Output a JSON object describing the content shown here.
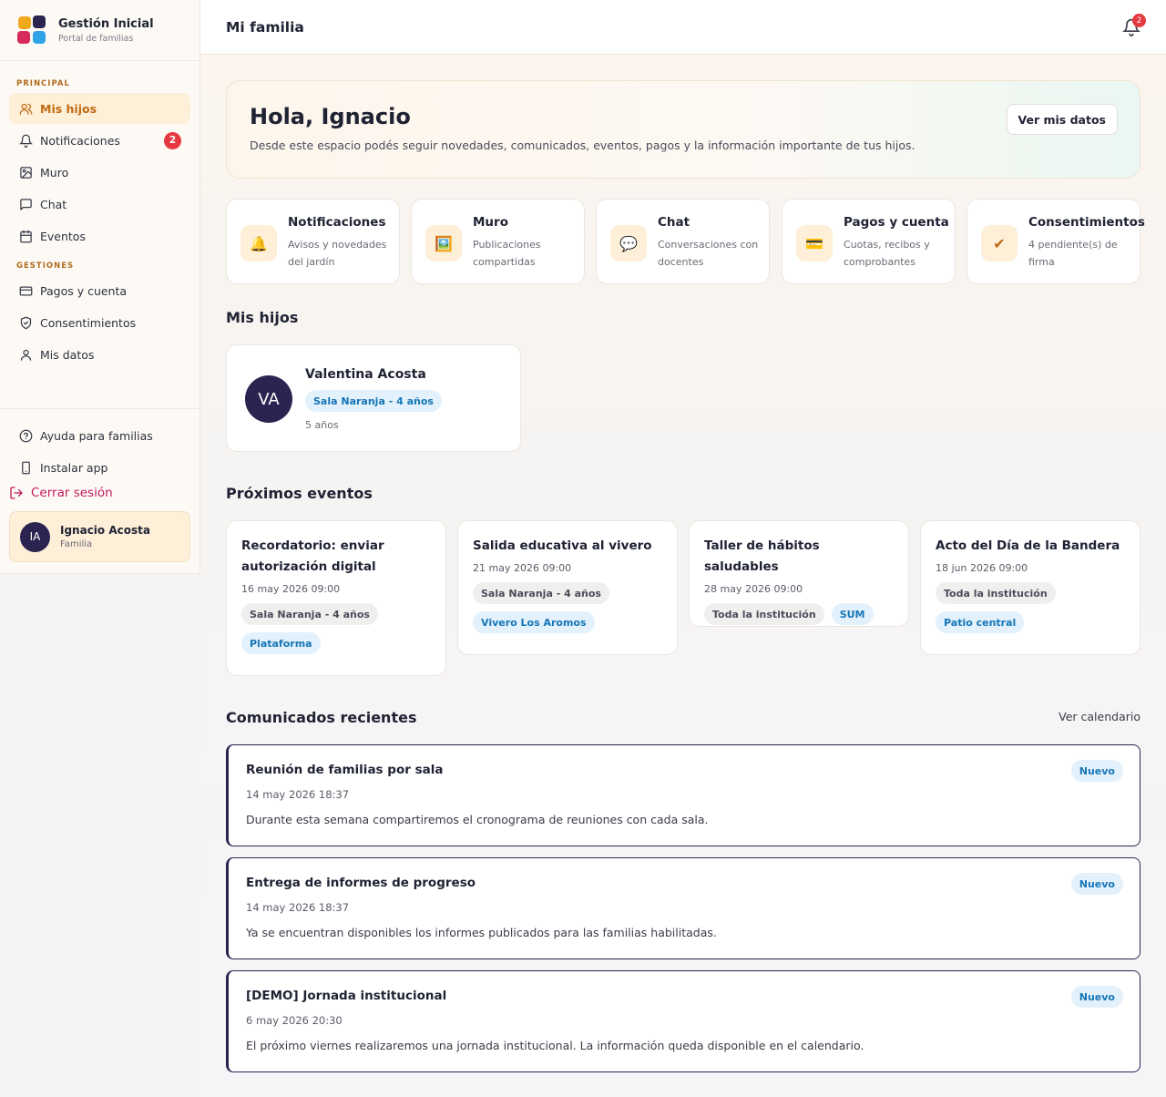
{
  "brand": {
    "title": "Gestión Inicial",
    "subtitle": "Portal de familias"
  },
  "sidebar": {
    "section_principal": "PRINCIPAL",
    "section_gestiones": "GESTIONES",
    "items": [
      {
        "label": "Mis hijos",
        "icon": "users-icon"
      },
      {
        "label": "Notificaciones",
        "icon": "bell-icon",
        "badge": "2"
      },
      {
        "label": "Muro",
        "icon": "image-icon"
      },
      {
        "label": "Chat",
        "icon": "chat-icon"
      },
      {
        "label": "Eventos",
        "icon": "calendar-icon"
      },
      {
        "label": "Pagos y cuenta",
        "icon": "credit-card-icon"
      },
      {
        "label": "Consentimientos",
        "icon": "shield-check-icon"
      },
      {
        "label": "Mis datos",
        "icon": "user-icon"
      },
      {
        "label": "Ayuda para familias",
        "icon": "help-circle-icon"
      },
      {
        "label": "Instalar app",
        "icon": "smartphone-icon"
      }
    ],
    "logout": "Cerrar sesión",
    "user": {
      "initials": "IA",
      "name": "Ignacio Acosta",
      "role": "Familia"
    }
  },
  "header": {
    "title": "Mi familia",
    "bell_badge": "2"
  },
  "hero": {
    "greeting": "Hola, Ignacio",
    "subtitle": "Desde este espacio podés seguir novedades, comunicados, eventos, pagos y la información importante de tus hijos.",
    "button": "Ver mis datos"
  },
  "quick_links": [
    {
      "title": "Notificaciones",
      "desc": "Avisos y novedades del jardín",
      "icon": "🔔"
    },
    {
      "title": "Muro",
      "desc": "Publicaciones compartidas",
      "icon": "🖼️"
    },
    {
      "title": "Chat",
      "desc": "Conversaciones con docentes",
      "icon": "💬"
    },
    {
      "title": "Pagos y cuenta",
      "desc": "Cuotas, recibos y comprobantes",
      "icon": "💳"
    },
    {
      "title": "Consentimientos",
      "desc": "4 pendiente(s) de firma",
      "icon": "✔"
    }
  ],
  "children_section": {
    "title": "Mis hijos",
    "child": {
      "initials": "VA",
      "name": "Valentina Acosta",
      "room": "Sala Naranja - 4 años",
      "age": "5 años"
    }
  },
  "events_section": {
    "title": "Próximos eventos",
    "events": [
      {
        "title": "Recordatorio: enviar autorización digital",
        "date": "16 may 2026 09:00",
        "tag1": "Sala Naranja - 4 años",
        "tag2": "Plataforma"
      },
      {
        "title": "Salida educativa al vivero",
        "date": "21 may 2026 09:00",
        "tag1": "Sala Naranja - 4 años",
        "tag2": "Vivero Los Aromos"
      },
      {
        "title": "Taller de hábitos saludables",
        "date": "28 may 2026 09:00",
        "tag1": "Toda la institución",
        "tag2": "SUM"
      },
      {
        "title": "Acto del Día de la Bandera",
        "date": "18 jun 2026 09:00",
        "tag1": "Toda la institución",
        "tag2": "Patio central"
      }
    ]
  },
  "notices_section": {
    "title": "Comunicados recientes",
    "link": "Ver calendario",
    "notices": [
      {
        "title": "Reunión de familias por sala",
        "date": "14 may 2026 18:37",
        "body": "Durante esta semana compartiremos el cronograma de reuniones con cada sala.",
        "badge": "Nuevo"
      },
      {
        "title": "Entrega de informes de progreso",
        "date": "14 may 2026 18:37",
        "body": "Ya se encuentran disponibles los informes publicados para las familias habilitadas.",
        "badge": "Nuevo"
      },
      {
        "title": "[DEMO] Jornada institucional",
        "date": "6 may 2026 20:30",
        "body": "El próximo viernes realizaremos una jornada institucional. La información queda disponible en el calendario.",
        "badge": "Nuevo"
      }
    ]
  },
  "colors": {
    "accent": "#c26a12",
    "navy": "#2b2350",
    "badge_red": "#e5393f",
    "tag_blue": "#1676b8"
  }
}
